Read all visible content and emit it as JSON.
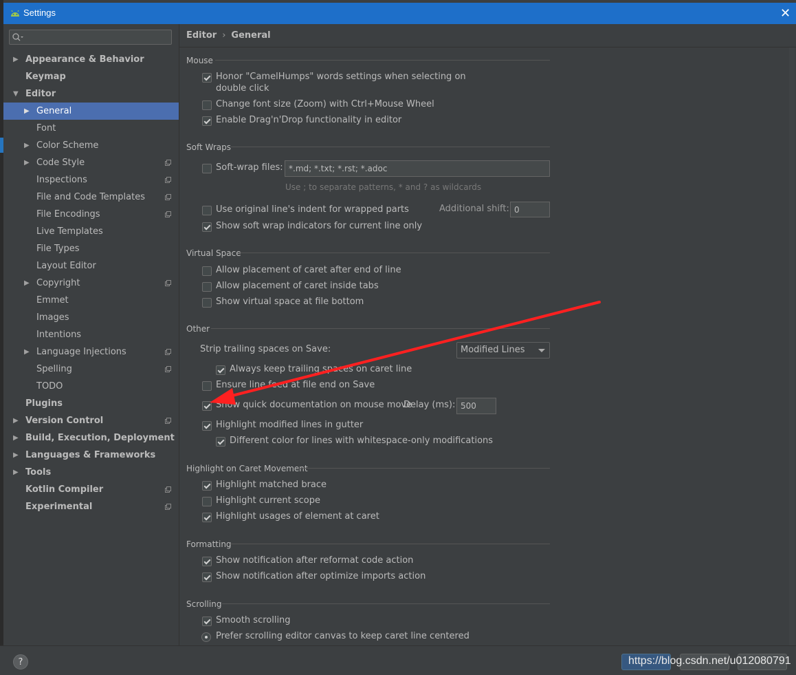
{
  "window": {
    "title": "Settings"
  },
  "search": {
    "placeholder": ""
  },
  "sidebar": {
    "items": [
      {
        "label": "Appearance & Behavior"
      },
      {
        "label": "Keymap"
      },
      {
        "label": "Editor"
      },
      {
        "label": "General"
      },
      {
        "label": "Font"
      },
      {
        "label": "Color Scheme"
      },
      {
        "label": "Code Style"
      },
      {
        "label": "Inspections"
      },
      {
        "label": "File and Code Templates"
      },
      {
        "label": "File Encodings"
      },
      {
        "label": "Live Templates"
      },
      {
        "label": "File Types"
      },
      {
        "label": "Layout Editor"
      },
      {
        "label": "Copyright"
      },
      {
        "label": "Emmet"
      },
      {
        "label": "Images"
      },
      {
        "label": "Intentions"
      },
      {
        "label": "Language Injections"
      },
      {
        "label": "Spelling"
      },
      {
        "label": "TODO"
      },
      {
        "label": "Plugins"
      },
      {
        "label": "Version Control"
      },
      {
        "label": "Build, Execution, Deployment"
      },
      {
        "label": "Languages & Frameworks"
      },
      {
        "label": "Tools"
      },
      {
        "label": "Kotlin Compiler"
      },
      {
        "label": "Experimental"
      }
    ]
  },
  "breadcrumb": {
    "parent": "Editor",
    "separator": "›",
    "current": "General"
  },
  "sections": {
    "mouse": {
      "title": "Mouse",
      "honor_line1": "Honor \"CamelHumps\" words settings when selecting on",
      "honor_line2": "double click",
      "zoom": "Change font size (Zoom) with Ctrl+Mouse Wheel",
      "dragdrop": "Enable Drag'n'Drop functionality in editor"
    },
    "soft_wraps": {
      "title": "Soft Wraps",
      "files_label": "Soft-wrap files:",
      "files_value": "*.md; *.txt; *.rst; *.adoc",
      "files_hint": "Use ; to separate patterns, * and ? as wildcards",
      "indent": "Use original line's indent for wrapped parts",
      "shift_label": "Additional shift:",
      "shift_value": "0",
      "indicators": "Show soft wrap indicators for current line only"
    },
    "virtual_space": {
      "title": "Virtual Space",
      "after_end": "Allow placement of caret after end of line",
      "inside_tabs": "Allow placement of caret inside tabs",
      "file_bottom": "Show virtual space at file bottom"
    },
    "other": {
      "title": "Other",
      "strip_label": "Strip trailing spaces on Save:",
      "strip_value": "Modified Lines",
      "keep_trailing": "Always keep trailing spaces on caret line",
      "line_feed": "Ensure line feed at file end on Save",
      "quick_doc": "Show quick documentation on mouse move",
      "delay_label": "Delay (ms):",
      "delay_value": "500",
      "highlight_modified": "Highlight modified lines in gutter",
      "diff_color": "Different color for lines with whitespace-only modifications"
    },
    "caret": {
      "title": "Highlight on Caret Movement",
      "brace": "Highlight matched brace",
      "scope": "Highlight current scope",
      "usages": "Highlight usages of element at caret"
    },
    "formatting": {
      "title": "Formatting",
      "reformat": "Show notification after reformat code action",
      "imports": "Show notification after optimize imports action"
    },
    "scrolling": {
      "title": "Scrolling",
      "smooth": "Smooth scrolling",
      "centered": "Prefer scrolling editor canvas to keep caret line centered"
    }
  },
  "footer": {
    "help": "?",
    "watermark": "https://blog.csdn.net/u012080791"
  },
  "colors": {
    "accent": "#4b6eaf",
    "titlebar": "#1e6fc9",
    "annotation_arrow": "#ff2020"
  }
}
